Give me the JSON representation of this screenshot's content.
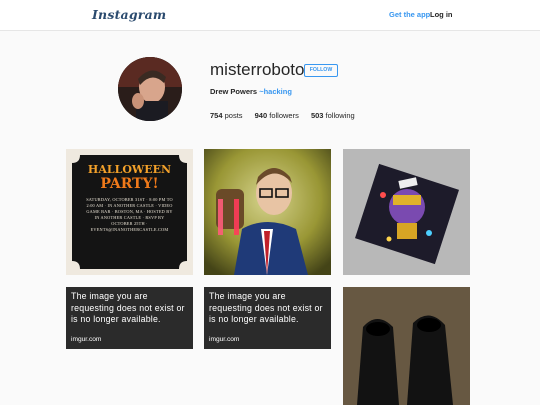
{
  "header": {
    "logo": "Instagram",
    "get_app": "Get the app",
    "login": "Log in"
  },
  "profile": {
    "username": "misterroboto",
    "follow_label": "FOLLOW",
    "full_name": "Drew Powers",
    "tag": "~hacking",
    "stats": {
      "posts_count": "754",
      "posts_label": "posts",
      "followers_count": "940",
      "followers_label": "followers",
      "following_count": "503",
      "following_label": "following"
    }
  },
  "posts": {
    "halloween": {
      "title_line1": "HALLOWEEN",
      "title_line2": "PARTY!",
      "details": "SATURDAY, OCTOBER 31ST · 8:00 PM TO 2:00 AM · IN ANOTHER CASTLE · VIDEO GAME BAR · BOSTON, MA · HOSTED BY IN ANOTHER CASTLE · RSVP BY OCTOBER 25TH · EVENTS@INANOTHERCASTLE.COM"
    },
    "imgur_1": {
      "message": "The image you are requesting does not exist or is no longer available.",
      "url": "imgur.com"
    },
    "imgur_2": {
      "message": "The image you are requesting does not exist or is no longer available.",
      "url": "imgur.com"
    }
  },
  "colors": {
    "accent": "#3897f0",
    "text": "#262626",
    "background": "#fafafa"
  }
}
